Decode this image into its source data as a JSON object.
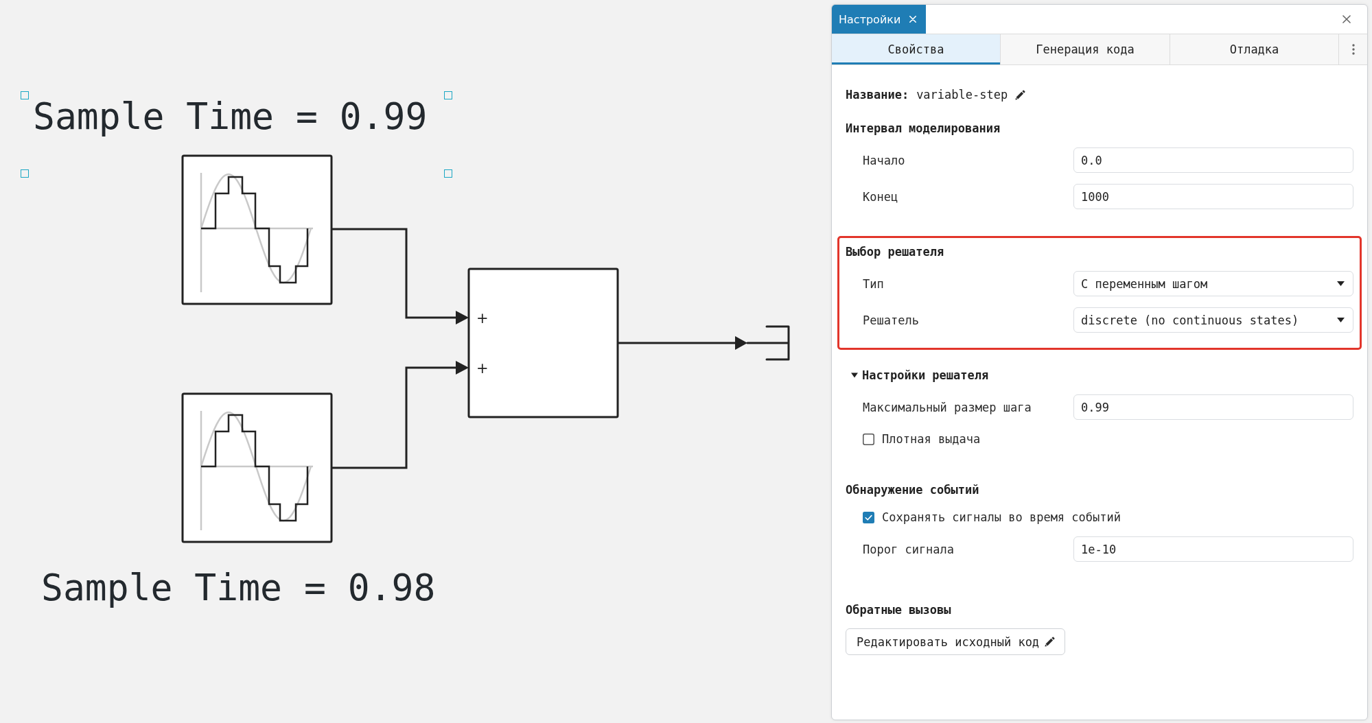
{
  "diagram": {
    "annotations": [
      {
        "text": "Sample Time = 0.99",
        "selected": true
      },
      {
        "text": "Sample Time = 0.98",
        "selected": false
      }
    ],
    "blocks": [
      {
        "kind": "discrete-sine"
      },
      {
        "kind": "discrete-sine"
      },
      {
        "kind": "sum",
        "signs": [
          "+",
          "+"
        ]
      },
      {
        "kind": "terminator"
      }
    ]
  },
  "panel": {
    "title": "Настройки",
    "tabs": [
      {
        "label": "Свойства",
        "selected": true
      },
      {
        "label": "Генерация кода",
        "selected": false
      },
      {
        "label": "Отладка",
        "selected": false
      }
    ],
    "name": {
      "label": "Название:",
      "value": "variable-step"
    },
    "sections": [
      {
        "kind": "group",
        "title": "Интервал моделирования",
        "highlighted": false,
        "fields": [
          {
            "kind": "input",
            "label": "Начало",
            "value": "0.0"
          },
          {
            "kind": "input",
            "label": "Конец",
            "value": "1000"
          }
        ]
      },
      {
        "kind": "group",
        "title": "Выбор решателя",
        "highlighted": true,
        "fields": [
          {
            "kind": "select",
            "label": "Тип",
            "value": "С переменным шагом"
          },
          {
            "kind": "select",
            "label": "Решатель",
            "value": "discrete (no continuous states)"
          }
        ]
      },
      {
        "kind": "collapsible",
        "title": "Настройки решателя",
        "highlighted": false,
        "expanded": true,
        "fields": [
          {
            "kind": "input",
            "label": "Максимальный размер шага",
            "value": "0.99"
          },
          {
            "kind": "checkbox",
            "label": "Плотная выдача",
            "checked": false
          }
        ]
      },
      {
        "kind": "group",
        "title": "Обнаружение событий",
        "highlighted": false,
        "fields": [
          {
            "kind": "checkbox",
            "label": "Сохранять сигналы во время событий",
            "checked": true
          },
          {
            "kind": "input",
            "label": "Порог сигнала",
            "value": "1e-10"
          }
        ]
      },
      {
        "kind": "group",
        "title": "Обратные вызовы",
        "highlighted": false,
        "fields": [
          {
            "kind": "button",
            "label": "Редактировать исходный код"
          }
        ]
      }
    ]
  }
}
